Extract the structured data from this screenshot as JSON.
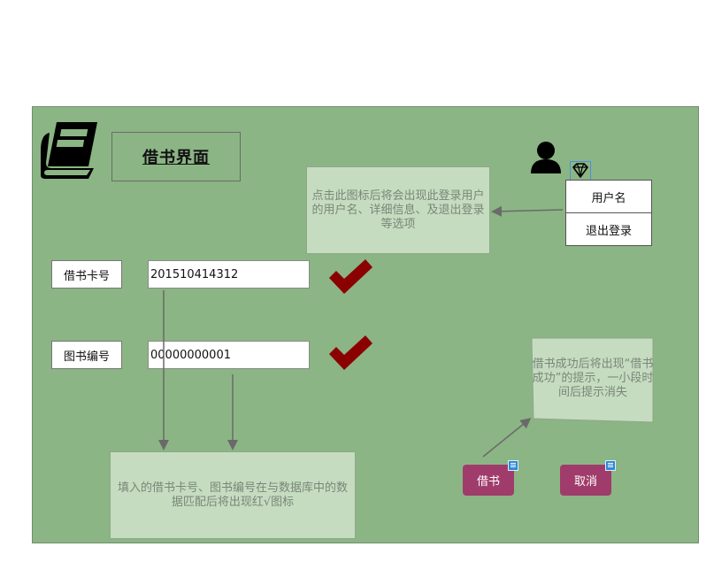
{
  "window": {
    "title": "借书界面"
  },
  "form": {
    "card_label": "借书卡号",
    "card_value": "201510414312",
    "book_label": "图书编号",
    "book_value": "00000000001"
  },
  "user_menu": {
    "username": "用户名",
    "logout": "退出登录"
  },
  "notes": {
    "user_icon_note": "点击此图标后将会出现此登录用户的用户名、详细信息、及退出登录等选项",
    "success_note": "借书成功后将出现“借书成功”的提示，一小段时间后提示消失",
    "match_note": "填入的借书卡号、图书编号在与数据库中的数据匹配后将出现红√图标"
  },
  "buttons": {
    "borrow": "借书",
    "cancel": "取消"
  },
  "icons": {
    "book": "book-icon",
    "user": "user-icon",
    "diamond": "diamond-icon",
    "check": "check-icon",
    "note": "note-icon"
  },
  "colors": {
    "panel": "#8bb584",
    "note_bg": "#c5dcc0",
    "button": "#a03c6b",
    "check": "#8b0000"
  }
}
